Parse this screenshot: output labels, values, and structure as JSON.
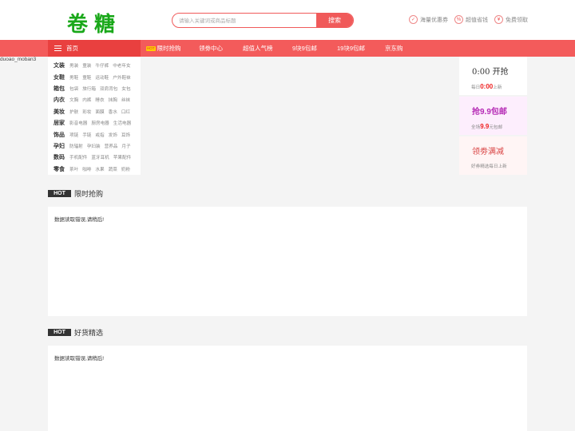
{
  "header": {
    "logo": "卷糖",
    "search_placeholder": "请输入关键词或商品标题",
    "search_button": "搜索",
    "perks": [
      {
        "icon": "check-icon",
        "label": "海量优惠券"
      },
      {
        "icon": "percent-icon",
        "label": "超值省钱"
      },
      {
        "icon": "yen-icon",
        "label": "免费领取"
      }
    ]
  },
  "nav": {
    "home": "首页",
    "hot_tag": "HOT",
    "items": [
      "限时抢购",
      "领劵中心",
      "超值人气榜",
      "9块9包邮",
      "19块9包邮",
      "京东购"
    ]
  },
  "template_name": "duoao_moban3",
  "categories": [
    {
      "name": "文装",
      "subs": [
        "男装",
        "童装",
        "牛仔裤",
        "中老年女"
      ]
    },
    {
      "name": "女鞋",
      "subs": [
        "男鞋",
        "童鞋",
        "运动鞋",
        "户外鞋袜"
      ]
    },
    {
      "name": "箱包",
      "subs": [
        "包袋",
        "旅行箱",
        "双肩背包",
        "女包"
      ]
    },
    {
      "name": "内衣",
      "subs": [
        "文胸",
        "内裤",
        "睡衣",
        "抹胸",
        "丝袜"
      ]
    },
    {
      "name": "美妆",
      "subs": [
        "护肤",
        "彩妆",
        "面膜",
        "香水",
        "口红"
      ]
    },
    {
      "name": "居家",
      "subs": [
        "影音电器",
        "厨房电器",
        "生活电器"
      ]
    },
    {
      "name": "饰品",
      "subs": [
        "项链",
        "手链",
        "戒指",
        "发饰",
        "耳饰"
      ]
    },
    {
      "name": "孕妇",
      "subs": [
        "防辐射",
        "孕妇装",
        "营养品",
        "月子"
      ]
    },
    {
      "name": "数码",
      "subs": [
        "手机配件",
        "蓝牙耳机",
        "苹果配件"
      ]
    },
    {
      "name": "零食",
      "subs": [
        "茶叶",
        "咖啡",
        "水果",
        "蔬菜",
        "奶粉"
      ]
    }
  ],
  "right_panel": {
    "flash": {
      "title": "0:00 开抢",
      "sub_pre": "每日",
      "sub_em": "0:00",
      "sub_post": "上新"
    },
    "nine": {
      "title": "抢9.9包邮",
      "sub_pre": "全场",
      "sub_em": "9.9",
      "sub_post": "元包邮"
    },
    "coupon": {
      "title": "领劵满减",
      "sub": "好券精选每日上新"
    }
  },
  "sections": [
    {
      "badge": "HOT",
      "title": "限时抢购",
      "message": "数据读取错误,请稍后!"
    },
    {
      "badge": "HOT",
      "title": "好货精选",
      "message": "数据读取错误,请稍后!"
    }
  ]
}
